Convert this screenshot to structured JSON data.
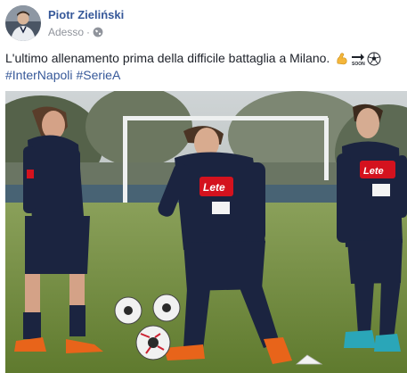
{
  "post": {
    "author": "Piotr Zieliński",
    "timestamp": "Adesso",
    "separator": "·",
    "privacy_icon": "globe-icon",
    "text": "L'ultimo allenamento prima della difficile battaglia a Milano.",
    "emojis": [
      "flexed-biceps",
      "soon-arrow",
      "soccer-ball"
    ],
    "hashtags": [
      "#InterNapoli",
      "#SerieA"
    ],
    "link_color": "#365899",
    "meta_color": "#90949c"
  },
  "photo": {
    "sponsor_logo": "Lete",
    "accent_colors": {
      "kit_navy": "#1b2440",
      "pitch": "#6f8a3c",
      "lete_red": "#d4121e",
      "boots_orange": "#e8641a"
    }
  }
}
